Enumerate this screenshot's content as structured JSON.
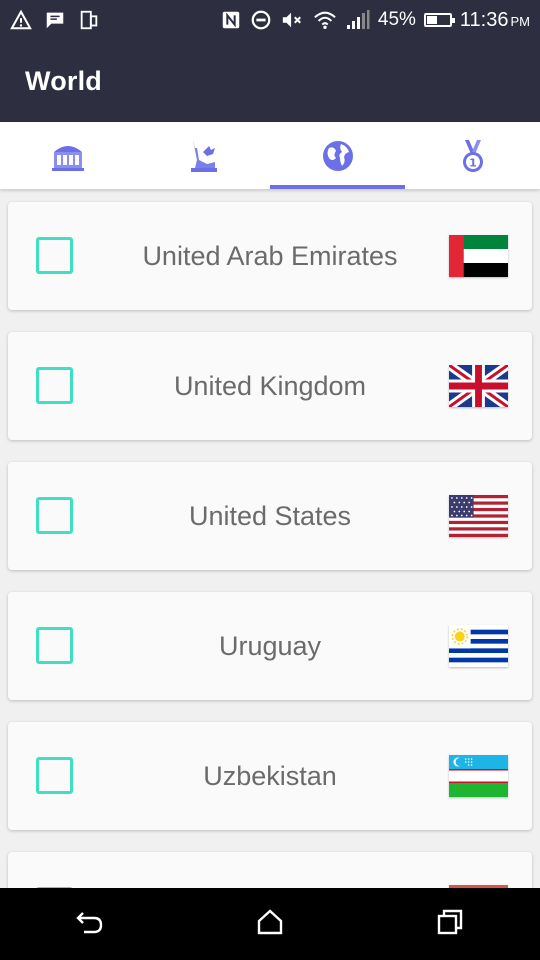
{
  "status_bar": {
    "battery": "45%",
    "battery_level": 0.45,
    "time": "11:36",
    "ampm": "PM",
    "icons": [
      "alert-icon",
      "message-icon",
      "phone-rotate-icon",
      "nfc-icon",
      "do-not-disturb-icon",
      "mute-icon",
      "wifi-icon",
      "signal-icon",
      "battery-icon"
    ]
  },
  "app_bar": {
    "title": "World"
  },
  "tabs": [
    {
      "icon": "museum-icon",
      "active": false
    },
    {
      "icon": "statue-of-liberty-icon",
      "active": false
    },
    {
      "icon": "globe-icon",
      "active": true
    },
    {
      "icon": "medal-icon",
      "active": false
    }
  ],
  "countries": [
    {
      "name": "United Arab Emirates",
      "flag": "uae-flag-icon",
      "checked": false
    },
    {
      "name": "United Kingdom",
      "flag": "uk-flag-icon",
      "checked": false
    },
    {
      "name": "United States",
      "flag": "us-flag-icon",
      "checked": false
    },
    {
      "name": "Uruguay",
      "flag": "uruguay-flag-icon",
      "checked": false
    },
    {
      "name": "Uzbekistan",
      "flag": "uzbekistan-flag-icon",
      "checked": false
    }
  ],
  "colors": {
    "header": "#2d2e40",
    "accent": "#6b6fe8",
    "checkbox": "#3fe0c2"
  },
  "nav_bar": {
    "icons": [
      "back-icon",
      "home-icon",
      "recents-icon"
    ]
  }
}
